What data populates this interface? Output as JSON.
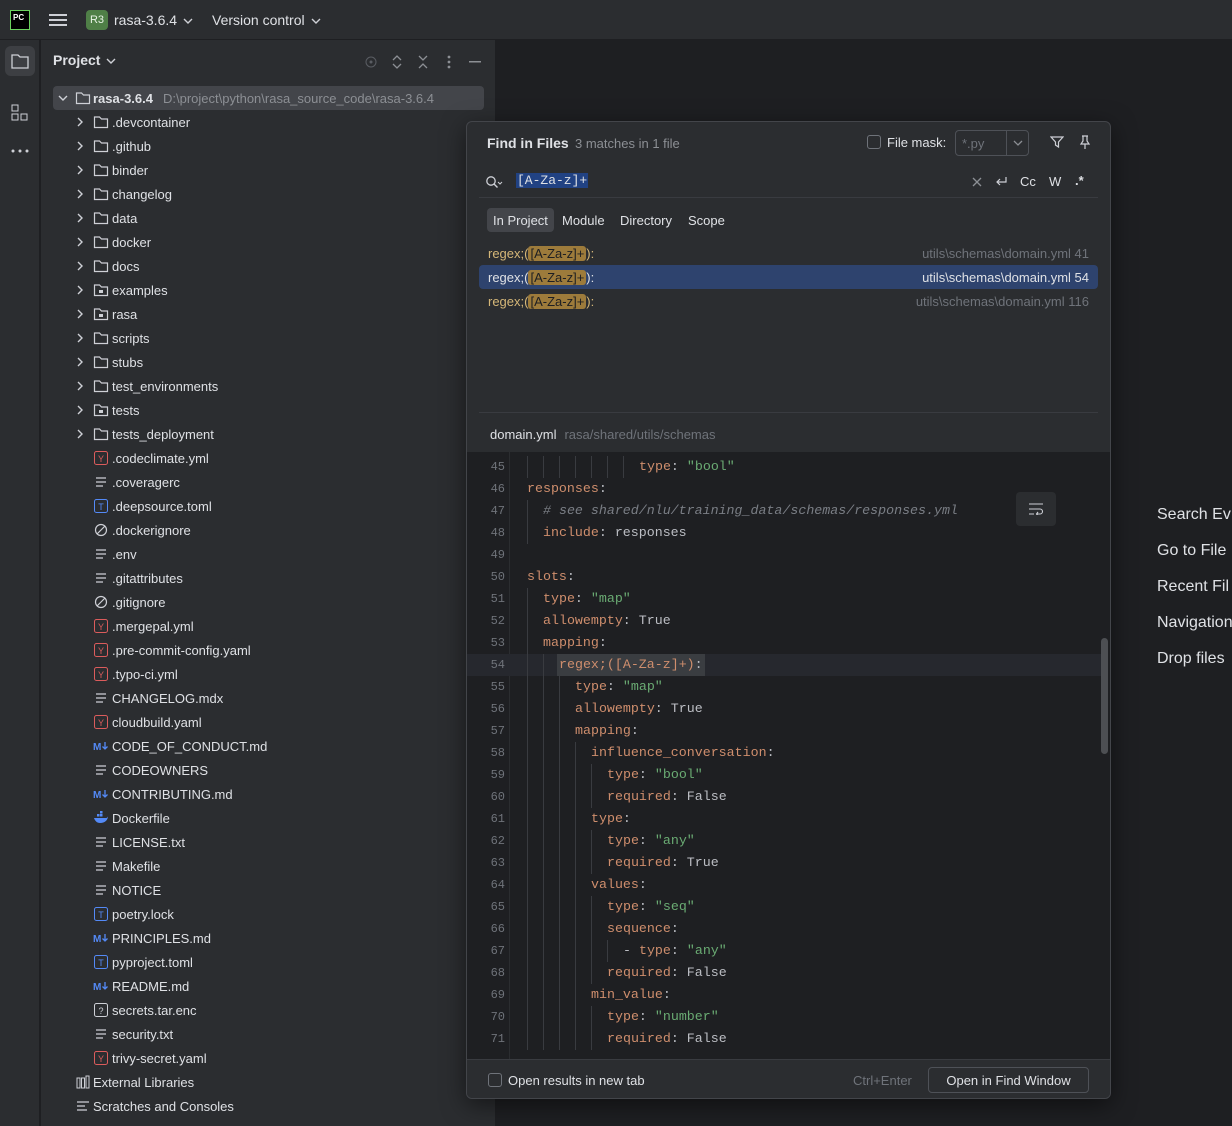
{
  "topbar": {
    "logo": "PC",
    "project_badge": "R3",
    "project_name": "rasa-3.6.4",
    "vcs_label": "Version control"
  },
  "project_panel": {
    "title": "Project",
    "root": {
      "name": "rasa-3.6.4",
      "path": "D:\\project\\python\\rasa_source_code\\rasa-3.6.4"
    },
    "items": [
      {
        "label": ".devcontainer",
        "icon": "folder-icon"
      },
      {
        "label": ".github",
        "icon": "folder-icon"
      },
      {
        "label": "binder",
        "icon": "folder-icon"
      },
      {
        "label": "changelog",
        "icon": "folder-icon"
      },
      {
        "label": "data",
        "icon": "folder-icon"
      },
      {
        "label": "docker",
        "icon": "folder-icon"
      },
      {
        "label": "docs",
        "icon": "folder-icon"
      },
      {
        "label": "examples",
        "icon": "package-folder-icon"
      },
      {
        "label": "rasa",
        "icon": "package-folder-icon"
      },
      {
        "label": "scripts",
        "icon": "folder-icon"
      },
      {
        "label": "stubs",
        "icon": "folder-icon"
      },
      {
        "label": "test_environments",
        "icon": "folder-icon"
      },
      {
        "label": "tests",
        "icon": "package-folder-icon"
      },
      {
        "label": "tests_deployment",
        "icon": "folder-icon"
      },
      {
        "label": ".codeclimate.yml",
        "icon": "yaml-icon"
      },
      {
        "label": ".coveragerc",
        "icon": "text-icon"
      },
      {
        "label": ".deepsource.toml",
        "icon": "toml-icon"
      },
      {
        "label": ".dockerignore",
        "icon": "ignore-icon"
      },
      {
        "label": ".env",
        "icon": "text-icon"
      },
      {
        "label": ".gitattributes",
        "icon": "text-icon"
      },
      {
        "label": ".gitignore",
        "icon": "ignore-icon"
      },
      {
        "label": ".mergepal.yml",
        "icon": "yaml-icon"
      },
      {
        "label": ".pre-commit-config.yaml",
        "icon": "yaml-icon"
      },
      {
        "label": ".typo-ci.yml",
        "icon": "yaml-icon"
      },
      {
        "label": "CHANGELOG.mdx",
        "icon": "text-icon"
      },
      {
        "label": "cloudbuild.yaml",
        "icon": "yaml-icon"
      },
      {
        "label": "CODE_OF_CONDUCT.md",
        "icon": "markdown-icon"
      },
      {
        "label": "CODEOWNERS",
        "icon": "text-icon"
      },
      {
        "label": "CONTRIBUTING.md",
        "icon": "markdown-icon"
      },
      {
        "label": "Dockerfile",
        "icon": "docker-icon"
      },
      {
        "label": "LICENSE.txt",
        "icon": "text-icon"
      },
      {
        "label": "Makefile",
        "icon": "text-icon"
      },
      {
        "label": "NOTICE",
        "icon": "text-icon"
      },
      {
        "label": "poetry.lock",
        "icon": "toml-icon"
      },
      {
        "label": "PRINCIPLES.md",
        "icon": "markdown-icon"
      },
      {
        "label": "pyproject.toml",
        "icon": "toml-icon"
      },
      {
        "label": "README.md",
        "icon": "markdown-icon"
      },
      {
        "label": "secrets.tar.enc",
        "icon": "unknown-file-icon"
      },
      {
        "label": "security.txt",
        "icon": "text-icon"
      },
      {
        "label": "trivy-secret.yaml",
        "icon": "yaml-icon"
      }
    ],
    "external_libraries": "External Libraries",
    "scratches": "Scratches and Consoles"
  },
  "editor_hints": [
    "Search Ev",
    "Go to File",
    "Recent Fil",
    "Navigation",
    "Drop files"
  ],
  "find_dialog": {
    "title": "Find in Files",
    "match_count": "3 matches in 1 file",
    "file_mask_label": "File mask:",
    "file_mask_placeholder": "*.py",
    "search_query": "[A-Za-z]+",
    "toggles": {
      "case": "Cc",
      "words": "W",
      "regex": ".*"
    },
    "scope_tabs": [
      "In Project",
      "Module",
      "Directory",
      "Scope"
    ],
    "results": [
      {
        "prefix": "regex;(",
        "match": "[A-Za-z]+",
        "suffix": "):",
        "file": "utils\\schemas\\domain.yml",
        "line": "41"
      },
      {
        "prefix": "regex;(",
        "match": "[A-Za-z]+",
        "suffix": "):",
        "file": "utils\\schemas\\domain.yml",
        "line": "54"
      },
      {
        "prefix": "regex;(",
        "match": "[A-Za-z]+",
        "suffix": "):",
        "file": "utils\\schemas\\domain.yml",
        "line": "116"
      }
    ],
    "preview_file": "domain.yml",
    "preview_path": "rasa/shared/utils/schemas",
    "code_lines": [
      {
        "n": "45",
        "indent": 7,
        "tokens": [
          [
            "k",
            "type"
          ],
          [
            "p",
            ": "
          ],
          [
            "s",
            "\"bool\""
          ]
        ]
      },
      {
        "n": "46",
        "indent": 0,
        "tokens": [
          [
            "k",
            "responses"
          ],
          [
            "p",
            ":"
          ]
        ]
      },
      {
        "n": "47",
        "indent": 1,
        "tokens": [
          [
            "c",
            "# see shared/nlu/training_data/schemas/responses.yml"
          ]
        ]
      },
      {
        "n": "48",
        "indent": 1,
        "tokens": [
          [
            "k",
            "include"
          ],
          [
            "p",
            ": responses"
          ]
        ]
      },
      {
        "n": "49",
        "indent": 0,
        "tokens": []
      },
      {
        "n": "50",
        "indent": 0,
        "tokens": [
          [
            "k",
            "slots"
          ],
          [
            "p",
            ":"
          ]
        ]
      },
      {
        "n": "51",
        "indent": 1,
        "tokens": [
          [
            "k",
            "type"
          ],
          [
            "p",
            ": "
          ],
          [
            "s",
            "\"map\""
          ]
        ]
      },
      {
        "n": "52",
        "indent": 1,
        "tokens": [
          [
            "k",
            "allowempty"
          ],
          [
            "p",
            ": True"
          ]
        ]
      },
      {
        "n": "53",
        "indent": 1,
        "tokens": [
          [
            "k",
            "mapping"
          ],
          [
            "p",
            ":"
          ]
        ]
      },
      {
        "n": "54",
        "indent": 2,
        "tokens": [
          [
            "k",
            "regex;([A-Za-z]+)"
          ],
          [
            "p",
            ":"
          ]
        ]
      },
      {
        "n": "55",
        "indent": 3,
        "tokens": [
          [
            "k",
            "type"
          ],
          [
            "p",
            ": "
          ],
          [
            "s",
            "\"map\""
          ]
        ]
      },
      {
        "n": "56",
        "indent": 3,
        "tokens": [
          [
            "k",
            "allowempty"
          ],
          [
            "p",
            ": True"
          ]
        ]
      },
      {
        "n": "57",
        "indent": 3,
        "tokens": [
          [
            "k",
            "mapping"
          ],
          [
            "p",
            ":"
          ]
        ]
      },
      {
        "n": "58",
        "indent": 4,
        "tokens": [
          [
            "k",
            "influence_conversation"
          ],
          [
            "p",
            ":"
          ]
        ]
      },
      {
        "n": "59",
        "indent": 5,
        "tokens": [
          [
            "k",
            "type"
          ],
          [
            "p",
            ": "
          ],
          [
            "s",
            "\"bool\""
          ]
        ]
      },
      {
        "n": "60",
        "indent": 5,
        "tokens": [
          [
            "k",
            "required"
          ],
          [
            "p",
            ": False"
          ]
        ]
      },
      {
        "n": "61",
        "indent": 4,
        "tokens": [
          [
            "k",
            "type"
          ],
          [
            "p",
            ":"
          ]
        ]
      },
      {
        "n": "62",
        "indent": 5,
        "tokens": [
          [
            "k",
            "type"
          ],
          [
            "p",
            ": "
          ],
          [
            "s",
            "\"any\""
          ]
        ]
      },
      {
        "n": "63",
        "indent": 5,
        "tokens": [
          [
            "k",
            "required"
          ],
          [
            "p",
            ": True"
          ]
        ]
      },
      {
        "n": "64",
        "indent": 4,
        "tokens": [
          [
            "k",
            "values"
          ],
          [
            "p",
            ":"
          ]
        ]
      },
      {
        "n": "65",
        "indent": 5,
        "tokens": [
          [
            "k",
            "type"
          ],
          [
            "p",
            ": "
          ],
          [
            "s",
            "\"seq\""
          ]
        ]
      },
      {
        "n": "66",
        "indent": 5,
        "tokens": [
          [
            "k",
            "sequence"
          ],
          [
            "p",
            ":"
          ]
        ]
      },
      {
        "n": "67",
        "indent": 6,
        "tokens": [
          [
            "p",
            "- "
          ],
          [
            "k",
            "type"
          ],
          [
            "p",
            ": "
          ],
          [
            "s",
            "\"any\""
          ]
        ]
      },
      {
        "n": "68",
        "indent": 5,
        "tokens": [
          [
            "k",
            "required"
          ],
          [
            "p",
            ": False"
          ]
        ]
      },
      {
        "n": "69",
        "indent": 4,
        "tokens": [
          [
            "k",
            "min_value"
          ],
          [
            "p",
            ":"
          ]
        ]
      },
      {
        "n": "70",
        "indent": 5,
        "tokens": [
          [
            "k",
            "type"
          ],
          [
            "p",
            ": "
          ],
          [
            "s",
            "\"number\""
          ]
        ]
      },
      {
        "n": "71",
        "indent": 5,
        "tokens": [
          [
            "k",
            "required"
          ],
          [
            "p",
            ": False"
          ]
        ]
      }
    ],
    "open_new_tab_label": "Open results in new tab",
    "shortcut": "Ctrl+Enter",
    "open_find_window_label": "Open in Find Window"
  }
}
